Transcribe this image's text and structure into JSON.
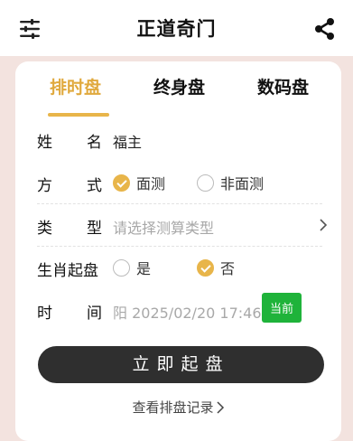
{
  "header": {
    "title": "正道奇门",
    "menu_icon": "sliders-icon",
    "share_icon": "share-icon"
  },
  "tabs": [
    {
      "label": "排时盘",
      "active": true
    },
    {
      "label": "终身盘",
      "active": false
    },
    {
      "label": "数码盘",
      "active": false
    }
  ],
  "form": {
    "name": {
      "label_1": "姓",
      "label_2": "名",
      "value": "福主"
    },
    "method": {
      "label_1": "方",
      "label_2": "式",
      "options": [
        {
          "label": "面测",
          "checked": true
        },
        {
          "label": "非面测",
          "checked": false
        }
      ]
    },
    "type": {
      "label_1": "类",
      "label_2": "型",
      "placeholder": "请选择测算类型"
    },
    "zodiac": {
      "label": "生肖起盘",
      "options": [
        {
          "label": "是",
          "checked": false
        },
        {
          "label": "否",
          "checked": true
        }
      ]
    },
    "time": {
      "label_1": "时",
      "label_2": "间",
      "value": "阳 2025/02/20 17:46",
      "now_label": "当前"
    }
  },
  "actions": {
    "start_label": "立即起盘",
    "records_label": "查看排盘记录"
  },
  "colors": {
    "accent": "#e8b54a",
    "now_button": "#1fb33a",
    "start_button": "#2f2f2f",
    "background": "#f3e3df"
  }
}
